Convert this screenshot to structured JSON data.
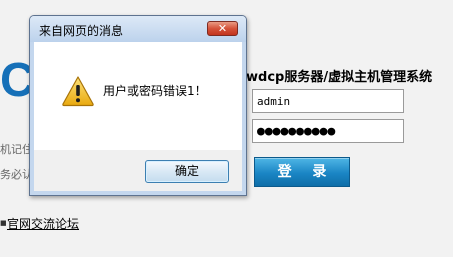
{
  "background": {
    "logo_fragment": "Cl",
    "system_title": "wdcp服务器/虚拟主机管理系统",
    "username": {
      "value": "admin"
    },
    "password": {
      "value": "●●●●●●●●●●"
    },
    "login_label": "登 录",
    "remember_fragment": "机记住",
    "notice_fragment": "务必认",
    "bullet": "■",
    "forum_link": "官网交流论坛"
  },
  "dialog": {
    "title": "来自网页的消息",
    "close_label": "✕",
    "message": "用户或密码错误1！",
    "icon": "warning-triangle-icon",
    "ok_label": "确定"
  },
  "colors": {
    "login_button": "#1a85c4",
    "dialog_frame": "#c4d7ee",
    "close_button": "#d5533a",
    "warning": "#f2c12e"
  }
}
